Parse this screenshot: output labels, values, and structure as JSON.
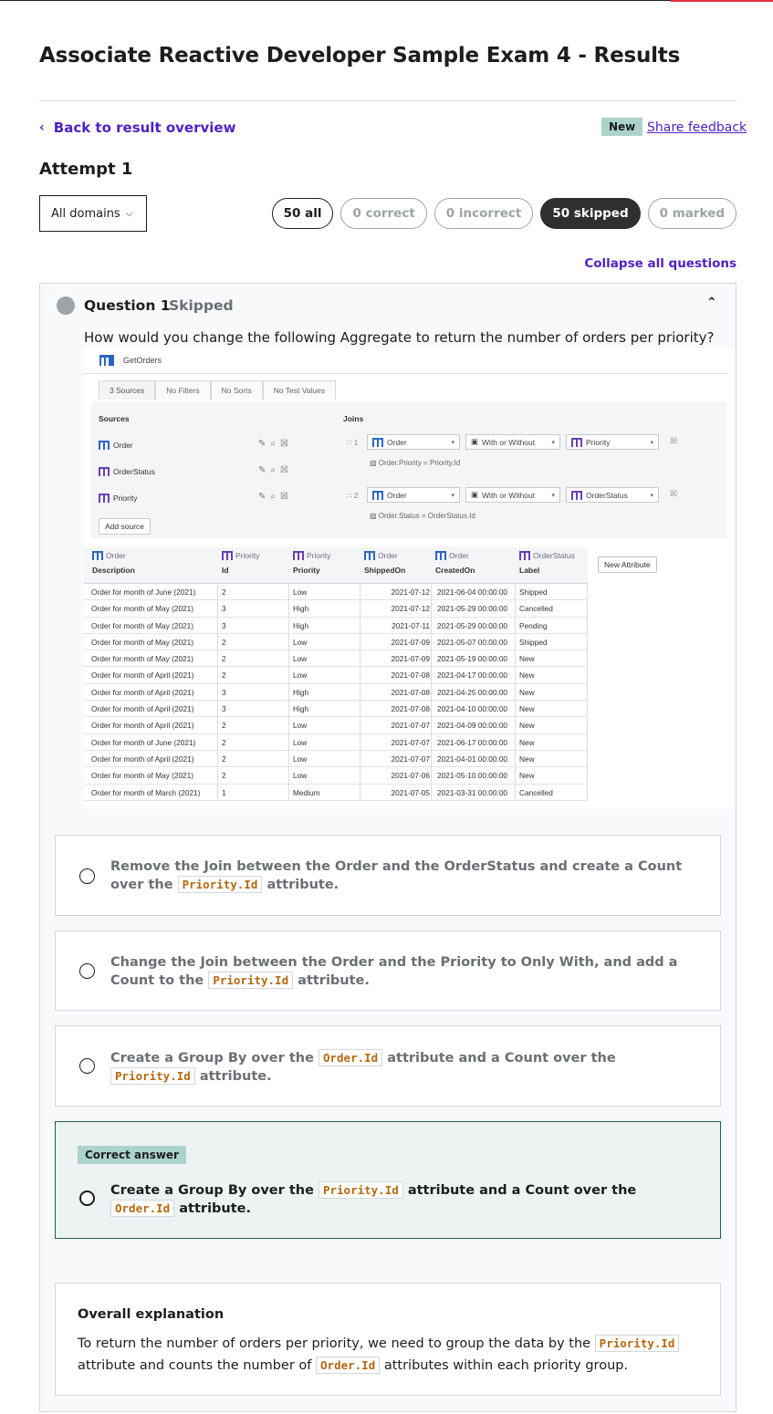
{
  "page": {
    "title": "Associate Reactive Developer Sample Exam 4 - Results",
    "back_link": "Back to result overview",
    "new_badge": "New",
    "share_feedback": "Share feedback",
    "attempt": "Attempt 1",
    "domain_filter": "All domains",
    "filters": [
      "50 all",
      "0 correct",
      "0 incorrect",
      "50 skipped",
      "0 marked"
    ],
    "collapse_all": "Collapse all questions"
  },
  "question": {
    "number": "Question 1",
    "status": "Skipped",
    "prompt": "How would you change the following Aggregate to return the number of orders per priority?",
    "image": {
      "aggregate_name": "GetOrders",
      "tabs": [
        "3 Sources",
        "No Filters",
        "No Sorts",
        "No Test Values"
      ],
      "sources_label": "Sources",
      "joins_label": "Joins",
      "sources": [
        "Order",
        "OrderStatus",
        "Priority"
      ],
      "add_source": "Add source",
      "joins": [
        {
          "num": "1",
          "left": "Order",
          "type": "With or Without",
          "right": "Priority",
          "condition": "Order.Priority = Priority.Id"
        },
        {
          "num": "2",
          "left": "Order",
          "type": "With or Without",
          "right": "OrderStatus",
          "condition": "Order.Status = OrderStatus.Id"
        }
      ],
      "columns": [
        {
          "entity": "Order",
          "name": "Description"
        },
        {
          "entity": "Priority",
          "name": "Id"
        },
        {
          "entity": "Priority",
          "name": "Priority"
        },
        {
          "entity": "Order",
          "name": "ShippedOn"
        },
        {
          "entity": "Order",
          "name": "CreatedOn"
        },
        {
          "entity": "OrderStatus",
          "name": "Label"
        }
      ],
      "new_attribute": "New Attribute",
      "rows": [
        [
          "Order for month of June (2021)",
          "2",
          "Low",
          "2021-07-12",
          "2021-06-04 00:00:00",
          "Shipped"
        ],
        [
          "Order for month of May (2021)",
          "3",
          "High",
          "2021-07-12",
          "2021-05-29 00:00:00",
          "Cancelled"
        ],
        [
          "Order for month of May (2021)",
          "3",
          "High",
          "2021-07-11",
          "2021-05-29 00:00:00",
          "Pending"
        ],
        [
          "Order for month of May (2021)",
          "2",
          "Low",
          "2021-07-09",
          "2021-05-07 00:00:00",
          "Shipped"
        ],
        [
          "Order for month of May (2021)",
          "2",
          "Low",
          "2021-07-09",
          "2021-05-19 00:00:00",
          "New"
        ],
        [
          "Order for month of April (2021)",
          "2",
          "Low",
          "2021-07-08",
          "2021-04-17 00:00:00",
          "New"
        ],
        [
          "Order for month of April (2021)",
          "3",
          "High",
          "2021-07-08",
          "2021-04-25 00:00:00",
          "New"
        ],
        [
          "Order for month of April (2021)",
          "3",
          "High",
          "2021-07-08",
          "2021-04-10 00:00:00",
          "New"
        ],
        [
          "Order for month of April (2021)",
          "2",
          "Low",
          "2021-07-07",
          "2021-04-09 00:00:00",
          "New"
        ],
        [
          "Order for month of June (2021)",
          "2",
          "Low",
          "2021-07-07",
          "2021-06-17 00:00:00",
          "New"
        ],
        [
          "Order for month of April (2021)",
          "2",
          "Low",
          "2021-07-07",
          "2021-04-01 00:00:00",
          "New"
        ],
        [
          "Order for month of May (2021)",
          "2",
          "Low",
          "2021-07-06",
          "2021-05-10 00:00:00",
          "New"
        ],
        [
          "Order for month of March (2021)",
          "1",
          "Medium",
          "2021-07-05",
          "2021-03-31 00:00:00",
          "Cancelled"
        ]
      ]
    },
    "answers": [
      {
        "pre": "Remove the Join between the Order and the OrderStatus and create a Count over the ",
        "code1": "Priority.Id",
        "mid": " attribute.",
        "code2": "",
        "post": ""
      },
      {
        "pre": "Change the Join between the Order and the Priority to Only With, and add a Count to the ",
        "code1": "Priority.Id",
        "mid": " attribute.",
        "code2": "",
        "post": ""
      },
      {
        "pre": "Create a Group By over the ",
        "code1": "Order.Id",
        "mid": " attribute and a Count over the ",
        "code2": "Priority.Id",
        "post": " attribute."
      },
      {
        "pre": "Create a Group By over the ",
        "code1": "Priority.Id",
        "mid": " attribute and a Count over the ",
        "code2": "Order.Id",
        "post": " attribute."
      }
    ],
    "correct_badge": "Correct answer",
    "explanation": {
      "title": "Overall explanation",
      "pre": "To return the number of orders per priority, we need to group the data by the ",
      "code1": "Priority.Id",
      "mid": " attribute and counts the number of ",
      "code2": "Order.Id",
      "post": " attributes within each priority group."
    }
  }
}
